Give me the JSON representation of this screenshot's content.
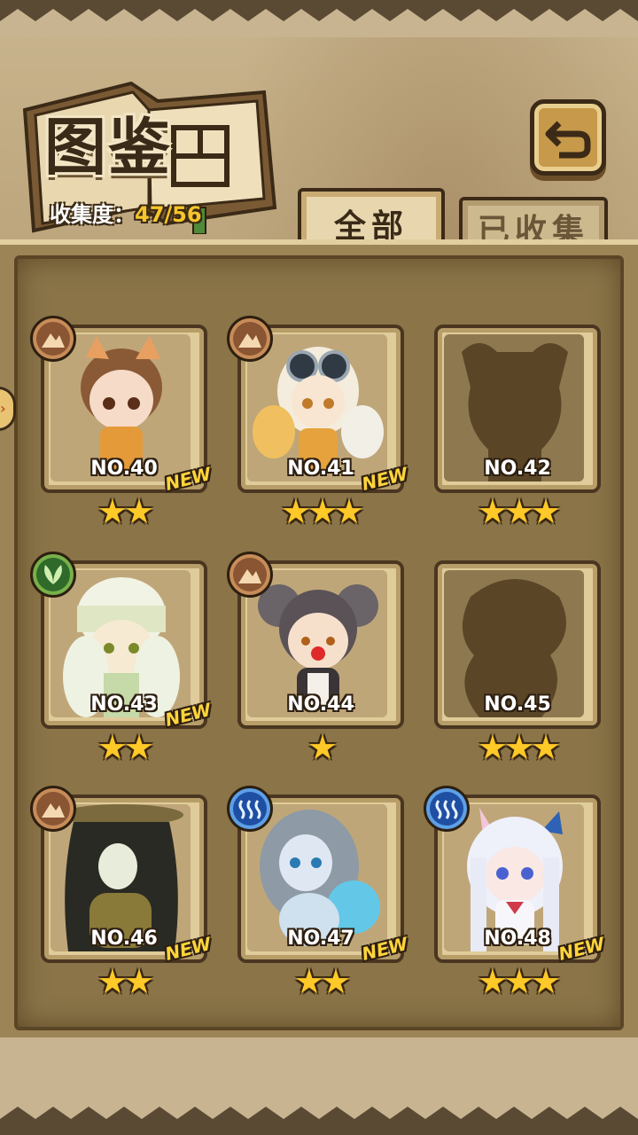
{
  "header": {
    "title": "图鉴",
    "progress_label": "收集度：",
    "progress_value": "47/56"
  },
  "tabs": [
    {
      "label": "全部",
      "active": true
    },
    {
      "label": "已收集",
      "active": false
    }
  ],
  "colors": {
    "star": "#ffc928",
    "new": "#ffd43b",
    "earth": "#8a5532",
    "leaf": "#2f6a2a",
    "water": "#1f4fa3"
  },
  "cards": [
    {
      "number": "NO.40",
      "stars": "★★",
      "new_label": "NEW",
      "element": "earth-icon",
      "silhouette": false
    },
    {
      "number": "NO.41",
      "stars": "★★★",
      "new_label": "NEW",
      "element": "earth-icon",
      "silhouette": false
    },
    {
      "number": "NO.42",
      "stars": "★★★",
      "new_label": "",
      "element": "",
      "silhouette": true
    },
    {
      "number": "NO.43",
      "stars": "★★",
      "new_label": "NEW",
      "element": "leaf-icon",
      "silhouette": false
    },
    {
      "number": "NO.44",
      "stars": "★",
      "new_label": "",
      "element": "earth-icon",
      "silhouette": false
    },
    {
      "number": "NO.45",
      "stars": "★★★",
      "new_label": "",
      "element": "",
      "silhouette": true
    },
    {
      "number": "NO.46",
      "stars": "★★",
      "new_label": "NEW",
      "element": "earth-icon",
      "silhouette": false
    },
    {
      "number": "NO.47",
      "stars": "★★",
      "new_label": "NEW",
      "element": "water-icon",
      "silhouette": false
    },
    {
      "number": "NO.48",
      "stars": "★★★",
      "new_label": "NEW",
      "element": "water-icon",
      "silhouette": false
    }
  ]
}
